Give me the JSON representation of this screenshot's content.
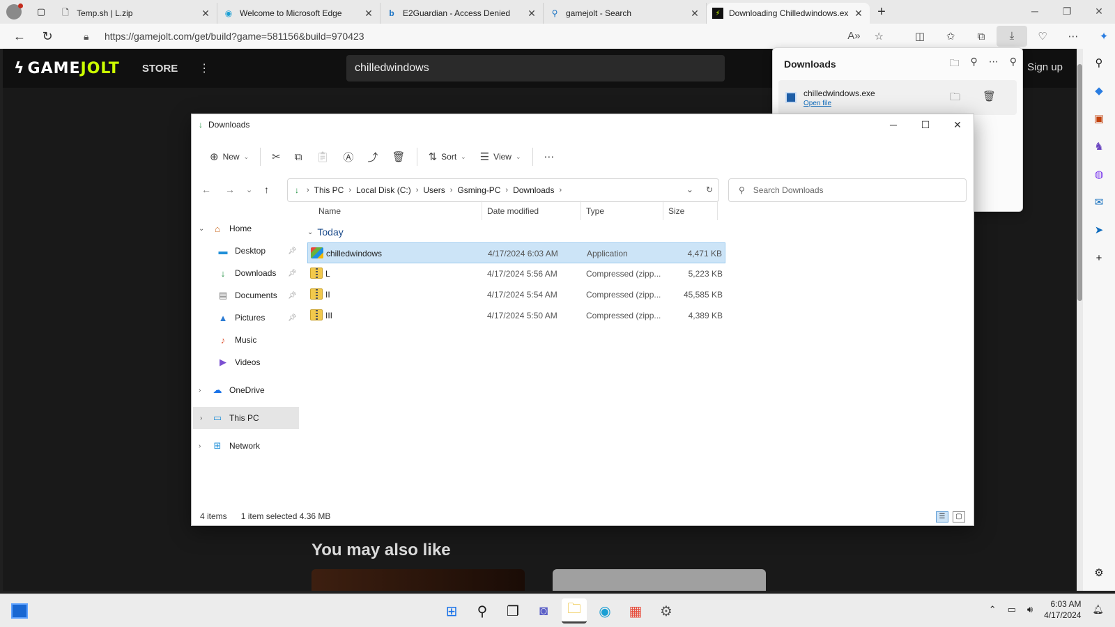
{
  "browser": {
    "tabs": [
      {
        "label": "Temp.sh | L.zip",
        "icon": "page-icon"
      },
      {
        "label": "Welcome to Microsoft Edge",
        "icon": "edge-icon"
      },
      {
        "label": "E2Guardian - Access Denied",
        "icon": "bing-icon"
      },
      {
        "label": "gamejolt - Search",
        "icon": "search-icon"
      },
      {
        "label": "Downloading Chilledwindows.ex",
        "icon": "gamejolt-icon",
        "active": true
      }
    ],
    "url": "https://gamejolt.com/get/build?game=581156&build=970423"
  },
  "site": {
    "logo_left": "GAME",
    "logo_right": "JOLT",
    "store_label": "STORE",
    "search_value": "chilledwindows",
    "signup_label": "Sign up",
    "may_also_like": "You may also like"
  },
  "downloads_panel": {
    "title": "Downloads",
    "item": {
      "filename": "chilledwindows.exe",
      "open_label": "Open file"
    }
  },
  "explorer": {
    "title": "Downloads",
    "toolbar": {
      "new_label": "New",
      "sort_label": "Sort",
      "view_label": "View"
    },
    "breadcrumb": [
      "This PC",
      "Local Disk (C:)",
      "Users",
      "Gsming-PC",
      "Downloads"
    ],
    "search_placeholder": "Search Downloads",
    "nav": {
      "home": "Home",
      "desktop": "Desktop",
      "downloads": "Downloads",
      "documents": "Documents",
      "pictures": "Pictures",
      "music": "Music",
      "videos": "Videos",
      "onedrive": "OneDrive",
      "thispc": "This PC",
      "network": "Network"
    },
    "columns": {
      "name": "Name",
      "date": "Date modified",
      "type": "Type",
      "size": "Size"
    },
    "group_label": "Today",
    "files": [
      {
        "name": "chilledwindows",
        "date": "4/17/2024 6:03 AM",
        "type": "Application",
        "size": "4,471 KB",
        "selected": true
      },
      {
        "name": "L",
        "date": "4/17/2024 5:56 AM",
        "type": "Compressed (zipp...",
        "size": "5,223 KB"
      },
      {
        "name": "II",
        "date": "4/17/2024 5:54 AM",
        "type": "Compressed (zipp...",
        "size": "45,585 KB"
      },
      {
        "name": "III",
        "date": "4/17/2024 5:50 AM",
        "type": "Compressed (zipp...",
        "size": "4,389 KB"
      }
    ],
    "status": {
      "items": "4 items",
      "selected": "1 item selected  4.36 MB"
    }
  },
  "taskbar": {
    "time": "6:03 AM",
    "date": "4/17/2024"
  },
  "colors": {
    "accent": "#0f6cbd",
    "selection": "#cce4f7",
    "gamejolt_green": "#ccff00"
  }
}
